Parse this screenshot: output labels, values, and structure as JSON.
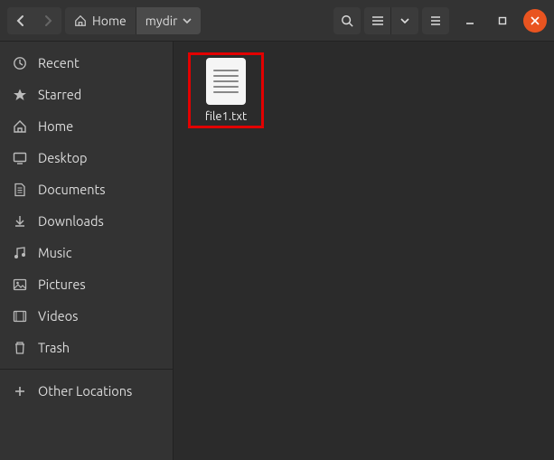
{
  "pathbar": {
    "home_label": "Home",
    "current_dir": "mydir"
  },
  "sidebar": {
    "items": [
      {
        "label": "Recent"
      },
      {
        "label": "Starred"
      },
      {
        "label": "Home"
      },
      {
        "label": "Desktop"
      },
      {
        "label": "Documents"
      },
      {
        "label": "Downloads"
      },
      {
        "label": "Music"
      },
      {
        "label": "Pictures"
      },
      {
        "label": "Videos"
      },
      {
        "label": "Trash"
      }
    ],
    "other_locations": "Other Locations"
  },
  "files": [
    {
      "name": "file1.txt",
      "selected": true
    }
  ]
}
